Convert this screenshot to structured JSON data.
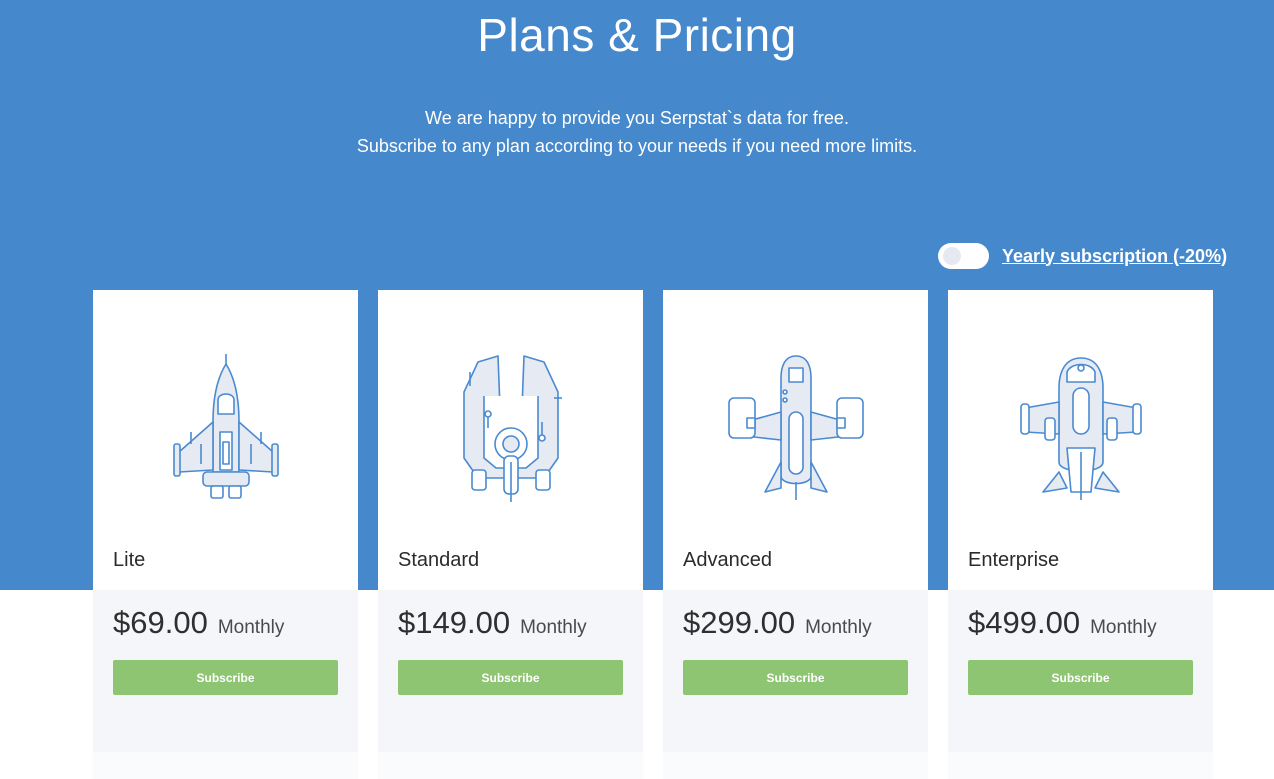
{
  "header": {
    "title": "Plans & Pricing",
    "subtitle_line1": "We are happy to provide you Serpstat`s data for free.",
    "subtitle_line2": "Subscribe to any plan according to your needs if you need more limits."
  },
  "billing_toggle": {
    "label": "Yearly subscription (-20%)",
    "enabled": false
  },
  "plans": [
    {
      "name": "Lite",
      "price": "$69.00",
      "period": "Monthly",
      "button": "Subscribe",
      "icon": "rocket-lite-icon"
    },
    {
      "name": "Standard",
      "price": "$149.00",
      "period": "Monthly",
      "button": "Subscribe",
      "icon": "rocket-standard-icon"
    },
    {
      "name": "Advanced",
      "price": "$299.00",
      "period": "Monthly",
      "button": "Subscribe",
      "icon": "rocket-advanced-icon"
    },
    {
      "name": "Enterprise",
      "price": "$499.00",
      "period": "Monthly",
      "button": "Subscribe",
      "icon": "rocket-enterprise-icon"
    }
  ],
  "colors": {
    "header_bg": "#4588cb",
    "button_bg": "#8dc572",
    "icon_stroke": "#4a8ad0"
  }
}
